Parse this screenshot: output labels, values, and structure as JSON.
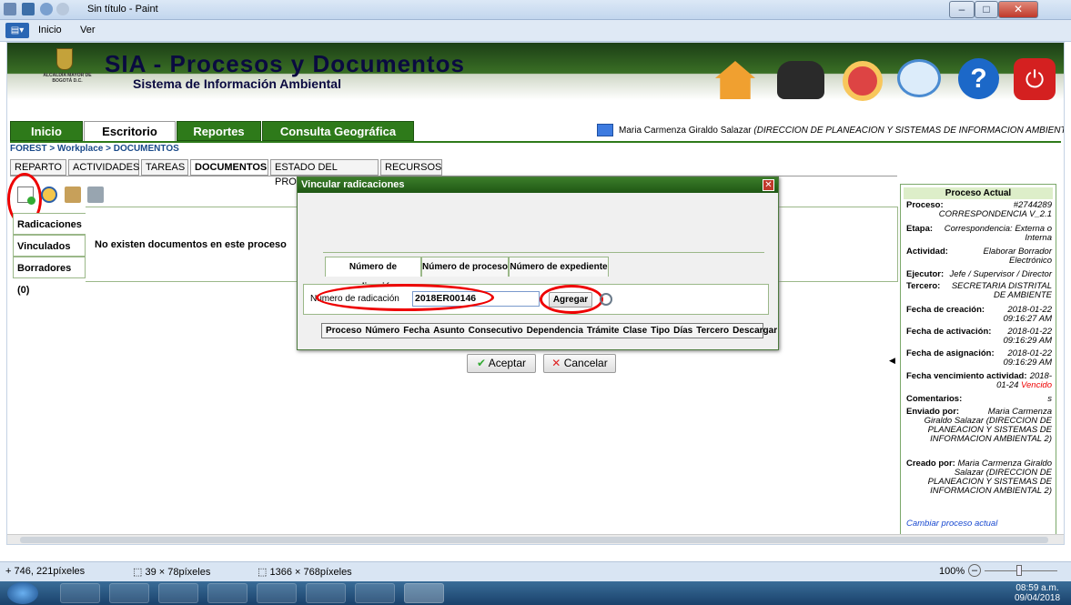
{
  "window": {
    "title": "Sin título - Paint",
    "menu_inicio": "Inicio",
    "menu_ver": "Ver"
  },
  "app": {
    "title": "SIA - Procesos y Documentos",
    "subtitle": "Sistema de Información Ambiental",
    "logo_text": "ALCALDÍA MAYOR DE BOGOTÁ D.C.",
    "tabs": [
      "Inicio",
      "Escritorio",
      "Reportes",
      "Consulta Geográfica"
    ],
    "user": "Maria Carmenza Giraldo Salazar",
    "user_dept": "(DIRECCION DE PLANEACION Y SISTEMAS DE INFORMACION AMBIENTAL 2)",
    "breadcrumb": "FOREST > Workplace > DOCUMENTOS",
    "subtabs": [
      "REPARTO",
      "ACTIVIDADES",
      "TAREAS",
      "DOCUMENTOS",
      "ESTADO DEL PROCESO",
      "RECURSOS"
    ],
    "left_tabs": [
      "Radicaciones (0)",
      "Vinculados (0)",
      "Borradores (0)"
    ],
    "empty_message": "No existen documentos en este proceso"
  },
  "dialog": {
    "title": "Vincular radicaciones",
    "tabs": [
      "Número de radicación",
      "Número de proceso",
      "Número de expediente"
    ],
    "field_label": "Número de radicación",
    "field_value": "2018ER00146",
    "add_button": "Agregar",
    "columns": [
      "Proceso",
      "Número",
      "Fecha",
      "Asunto",
      "Consecutivo",
      "Dependencia",
      "Trámite",
      "Clase",
      "Tipo",
      "Días",
      "Tercero",
      "Descargar"
    ],
    "accept": "Aceptar",
    "cancel": "Cancelar"
  },
  "panel": {
    "title": "Proceso Actual",
    "proceso_label": "Proceso:",
    "proceso_value": "#2744289 CORRESPONDENCIA V_2.1",
    "etapa_label": "Etapa:",
    "etapa_value": "Correspondencia: Externa o Interna",
    "actividad_label": "Actividad:",
    "actividad_value": "Elaborar Borrador Electrónico",
    "ejecutor_label": "Ejecutor:",
    "ejecutor_value": "Jefe / Supervisor / Director",
    "tercero_label": "Tercero:",
    "tercero_value": "SECRETARIA DISTRITAL DE AMBIENTE",
    "creacion_label": "Fecha de creación:",
    "creacion_value": "2018-01-22 09:16:27 AM",
    "activacion_label": "Fecha de activación:",
    "activacion_value": "2018-01-22 09:16:29 AM",
    "asignacion_label": "Fecha de asignación:",
    "asignacion_value": "2018-01-22 09:16:29 AM",
    "venc_label": "Fecha vencimiento actividad:",
    "venc_value": "2018-01-24",
    "venc_status": "Vencido",
    "comentarios_label": "Comentarios:",
    "comentarios_value": "s",
    "enviado_label": "Enviado por:",
    "enviado_value": "Maria Carmenza Giraldo Salazar (DIRECCION DE PLANEACION Y SISTEMAS DE INFORMACION AMBIENTAL 2)",
    "creado_label": "Creado por:",
    "creado_value": "Maria Carmenza Giraldo Salazar (DIRECCION DE PLANEACION Y SISTEMAS DE INFORMACION AMBIENTAL 2)",
    "link": "Cambiar proceso actual"
  },
  "statusbar": {
    "cursor": "746, 221píxeles",
    "selection": "39 × 78píxeles",
    "size": "1366 × 768píxeles",
    "zoom": "100%"
  },
  "taskbar": {
    "time": "08:59 a.m.",
    "date": "09/04/2018"
  },
  "colors": {
    "green": "#2e7a1a",
    "red_ring": "#e00000"
  }
}
